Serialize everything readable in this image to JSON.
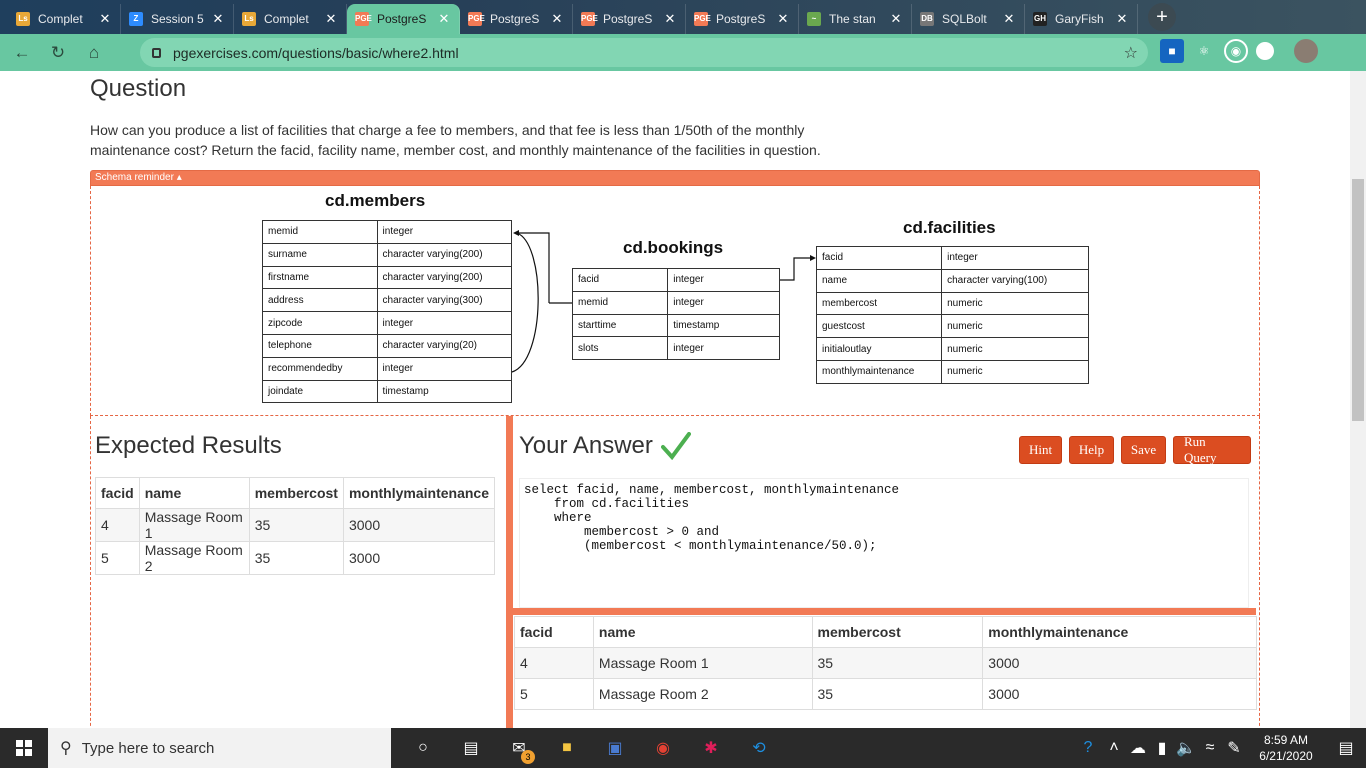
{
  "browser": {
    "tabs": [
      {
        "title": "Complet",
        "fav": "Ls",
        "favcolor": "#e8a838"
      },
      {
        "title": "Session 5",
        "fav": "Z",
        "favcolor": "#2d8cff"
      },
      {
        "title": "Complet",
        "fav": "Ls",
        "favcolor": "#e8a838"
      },
      {
        "title": "PostgreS",
        "fav": "PGE",
        "favcolor": "#f27a55"
      },
      {
        "title": "PostgreS",
        "fav": "PGE",
        "favcolor": "#f27a55"
      },
      {
        "title": "PostgreS",
        "fav": "PGE",
        "favcolor": "#f27a55"
      },
      {
        "title": "PostgreS",
        "fav": "PGE",
        "favcolor": "#f27a55"
      },
      {
        "title": "The stan",
        "fav": "~",
        "favcolor": "#6aa84f"
      },
      {
        "title": "SQLBolt",
        "fav": "DB",
        "favcolor": "#777"
      },
      {
        "title": "GaryFish",
        "fav": "GH",
        "favcolor": "#222"
      }
    ],
    "active_tab": 3,
    "url": "pgexercises.com/questions/basic/where2.html"
  },
  "question": {
    "title": "Question",
    "text": "How can you produce a list of facilities that charge a fee to members, and that fee is less than 1/50th of the monthly maintenance cost? Return the facid, facility name, member cost, and monthly maintenance of the facilities in question."
  },
  "schema": {
    "toggle_label": "Schema reminder ▴",
    "members": {
      "title": "cd.members",
      "rows": [
        [
          "memid",
          "integer"
        ],
        [
          "surname",
          "character varying(200)"
        ],
        [
          "firstname",
          "character varying(200)"
        ],
        [
          "address",
          "character varying(300)"
        ],
        [
          "zipcode",
          "integer"
        ],
        [
          "telephone",
          "character varying(20)"
        ],
        [
          "recommendedby",
          "integer"
        ],
        [
          "joindate",
          "timestamp"
        ]
      ]
    },
    "bookings": {
      "title": "cd.bookings",
      "rows": [
        [
          "facid",
          "integer"
        ],
        [
          "memid",
          "integer"
        ],
        [
          "starttime",
          "timestamp"
        ],
        [
          "slots",
          "integer"
        ]
      ]
    },
    "facilities": {
      "title": "cd.facilities",
      "rows": [
        [
          "facid",
          "integer"
        ],
        [
          "name",
          "character varying(100)"
        ],
        [
          "membercost",
          "numeric"
        ],
        [
          "guestcost",
          "numeric"
        ],
        [
          "initialoutlay",
          "numeric"
        ],
        [
          "monthlymaintenance",
          "numeric"
        ]
      ]
    }
  },
  "expected": {
    "title": "Expected Results",
    "columns": [
      "facid",
      "name",
      "membercost",
      "monthlymaintenance"
    ],
    "rows": [
      [
        "4",
        "Massage Room 1",
        "35",
        "3000"
      ],
      [
        "5",
        "Massage Room 2",
        "35",
        "3000"
      ]
    ]
  },
  "answer": {
    "title": "Your Answer",
    "buttons": {
      "hint": "Hint",
      "help": "Help",
      "save": "Save",
      "run": "Run Query"
    },
    "code_lines": [
      "select facid, name, membercost, monthlymaintenance",
      "    from cd.facilities",
      "    where",
      "        membercost > 0 and",
      "        (membercost < monthlymaintenance/50.0);"
    ],
    "columns": [
      "facid",
      "name",
      "membercost",
      "monthlymaintenance"
    ],
    "rows": [
      [
        "4",
        "Massage Room 1",
        "35",
        "3000"
      ],
      [
        "5",
        "Massage Room 2",
        "35",
        "3000"
      ]
    ]
  },
  "taskbar": {
    "search_placeholder": "Type here to search",
    "time": "8:59 AM",
    "date": "6/21/2020",
    "mail_badge": "3"
  }
}
